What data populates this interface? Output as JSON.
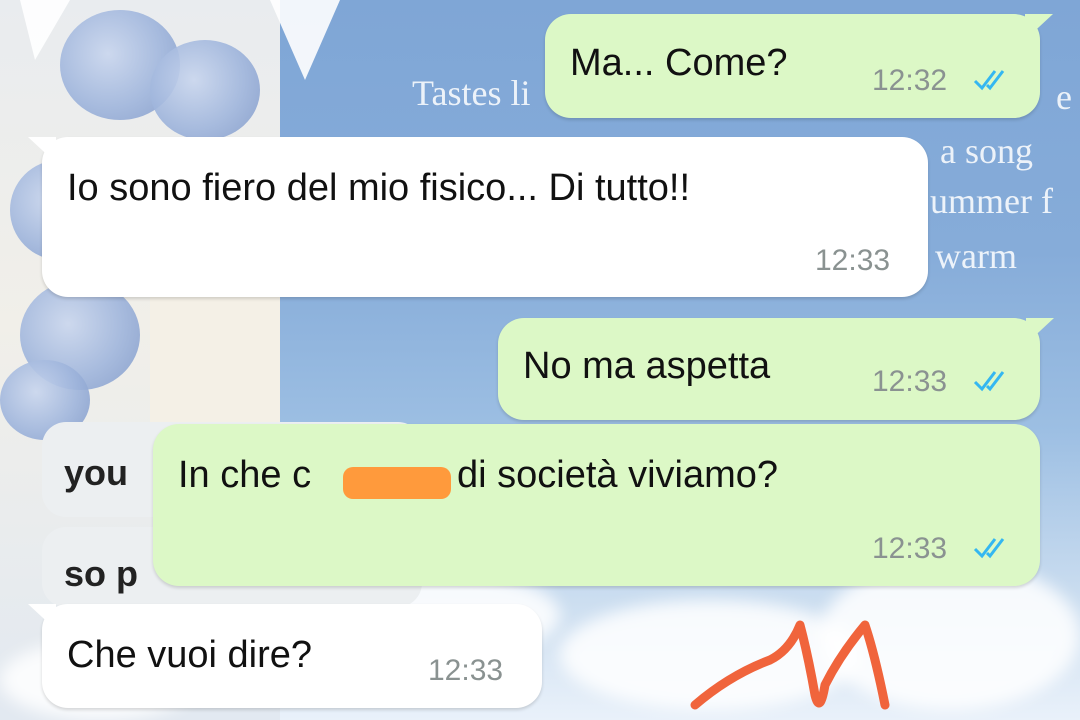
{
  "background": {
    "text_lines": [
      "Tastes li",
      "a song",
      "ummer f",
      "warm",
      "e"
    ]
  },
  "ghost_bubbles": [
    {
      "text": "you"
    },
    {
      "text": "so p"
    }
  ],
  "messages": [
    {
      "direction": "outgoing",
      "text": "Ma... Come?",
      "time": "12:32",
      "status": "read-double-check"
    },
    {
      "direction": "incoming",
      "text": "Io sono fiero del mio fisico... Di tutto!!",
      "time": "12:33"
    },
    {
      "direction": "outgoing",
      "text": "No ma aspetta",
      "time": "12:33",
      "status": "read-double-check"
    },
    {
      "direction": "outgoing",
      "text_before": "In che c",
      "text_after": "di società viviamo?",
      "time": "12:33",
      "status": "read-double-check",
      "censored": true
    },
    {
      "direction": "incoming",
      "text": "Che vuoi dire?",
      "time": "12:33"
    }
  ],
  "colors": {
    "outgoing_bubble": "#dcf8c6",
    "incoming_bubble": "#ffffff",
    "read_ticks": "#34b7f1",
    "censor_mark": "#ff9a3c",
    "scribble": "#f0643c"
  }
}
